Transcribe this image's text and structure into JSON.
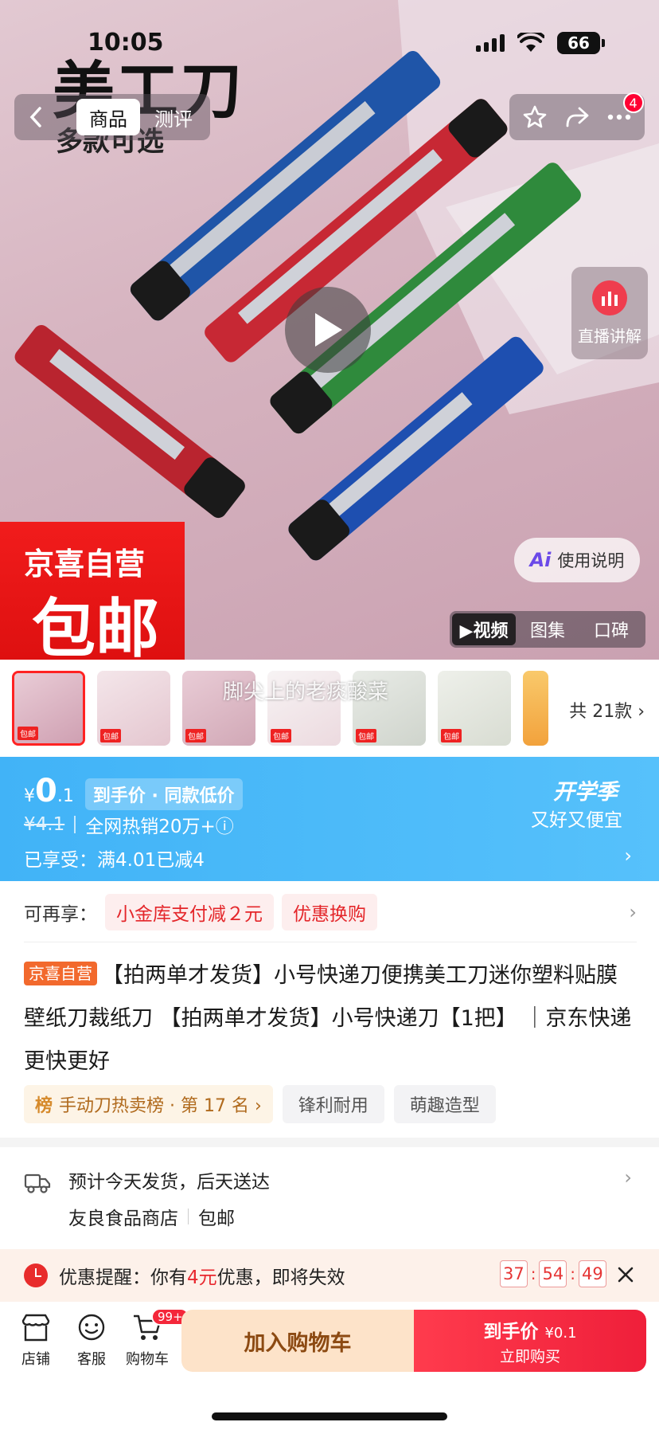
{
  "status_bar": {
    "time": "10:05",
    "battery": "66"
  },
  "hero": {
    "title": "美工刀",
    "subtitle": "多款可选",
    "tabs": [
      "商品",
      "测评"
    ],
    "notification_count": "4",
    "live_label": "直播讲解",
    "promo_line1": "京喜自营",
    "promo_line2": "包邮",
    "ai_label": "使用说明",
    "media_tabs": [
      "▶视频",
      "图集",
      "口碑"
    ]
  },
  "thumbs": {
    "watermark": "脚尖上的老痰酸菜",
    "total": "共 21款 ›",
    "tag": "包邮"
  },
  "price": {
    "currency": "¥",
    "int": "0",
    "dec": ".1",
    "tag": "到手价 · 同款低价",
    "original": "¥4.1",
    "sales": "全网热销20万+ⓘ",
    "enjoyed": "已享受：满4.01已减4",
    "season_title": "开学季",
    "season_sub": "又好又便宜"
  },
  "coupons": {
    "label": "可再享：",
    "chips": [
      "小金库支付减２元",
      "优惠换购"
    ]
  },
  "product": {
    "tag": "京喜自营",
    "title": "【拍两单才发货】小号快递刀便携美工刀迷你塑料贴膜壁纸刀裁纸刀 【拍两单才发货】小号快递刀【1把】 ｜京东快递 更快更好",
    "rank_mark": "榜",
    "rank": "手动刀热卖榜 · 第 17 名 ›",
    "features": [
      "锋利耐用",
      "萌趣造型"
    ]
  },
  "delivery": {
    "line1": "预计今天发货，后天送达",
    "shop": "友良食品商店",
    "shipping": "包邮"
  },
  "reminder": {
    "prefix": "优惠提醒：你有",
    "amount": "4元",
    "suffix": "优惠，即将失效",
    "hours": "37",
    "minutes": "54",
    "seconds": "49"
  },
  "bottom_bar": {
    "shop": "店铺",
    "service": "客服",
    "cart": "购物车",
    "cart_badge": "99+",
    "add_cart": "加入购物车",
    "buy_price_label": "到手价",
    "buy_price": "¥0.1",
    "buy_sub": "立即购买"
  },
  "colors": {
    "accent_red": "#f0192f",
    "price_blue": "#41b3f7",
    "cart_bg": "#fde3c9"
  }
}
